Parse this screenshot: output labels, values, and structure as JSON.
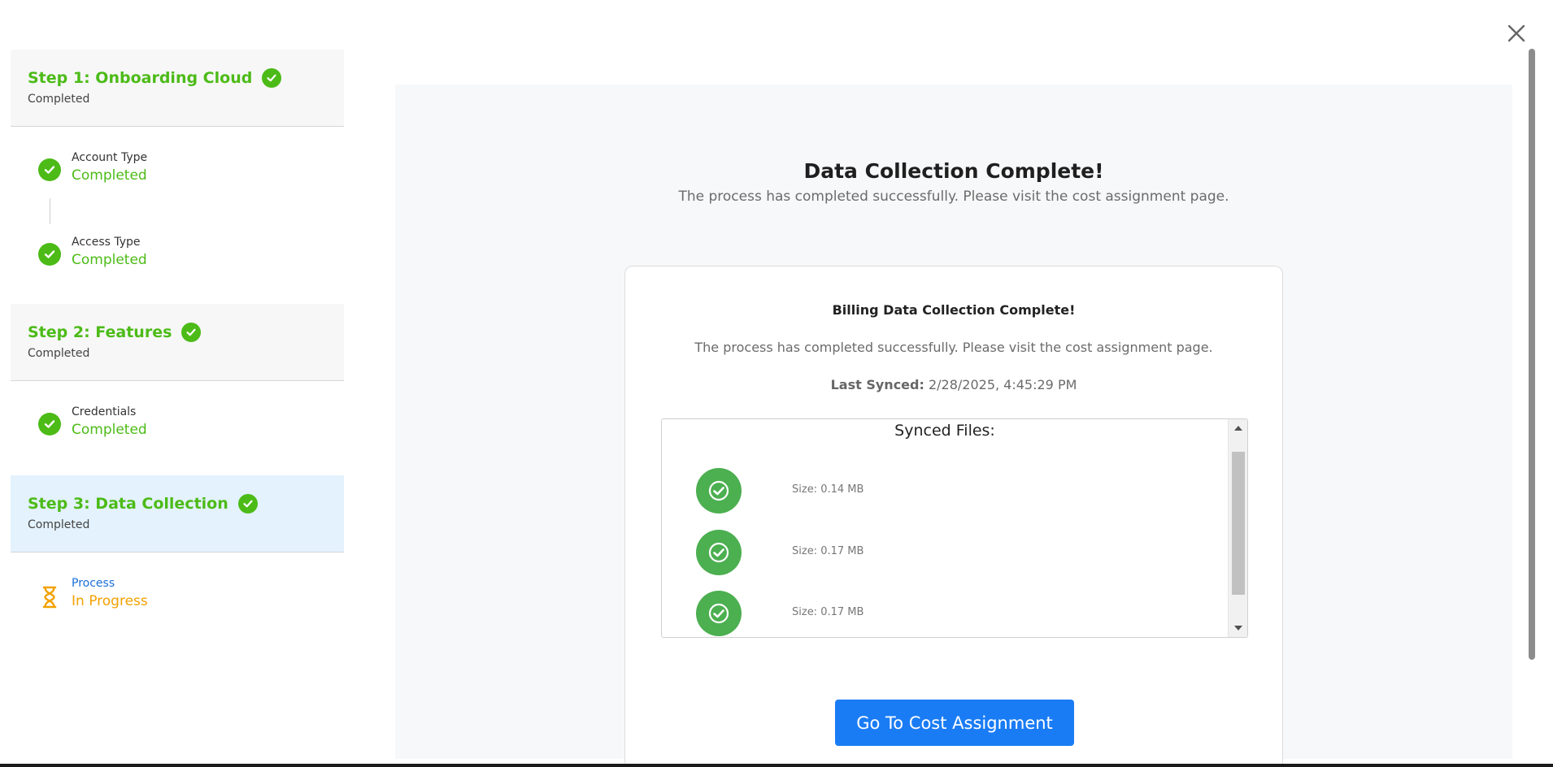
{
  "sidebar": {
    "steps": [
      {
        "title": "Step 1: Onboarding Cloud",
        "status": "Completed",
        "substeps": [
          {
            "label": "Account Type",
            "status": "Completed"
          },
          {
            "label": "Access Type",
            "status": "Completed"
          }
        ]
      },
      {
        "title": "Step 2: Features",
        "status": "Completed",
        "substeps": [
          {
            "label": "Credentials",
            "status": "Completed"
          }
        ]
      },
      {
        "title": "Step 3: Data Collection",
        "status": "Completed",
        "substeps": [
          {
            "label": "Process",
            "status": "In Progress",
            "icon": "hourglass-icon"
          }
        ]
      }
    ]
  },
  "main": {
    "title": "Data Collection Complete!",
    "subtitle": "The process has completed successfully. Please visit the cost assignment page.",
    "card": {
      "title": "Billing Data Collection Complete!",
      "subtitle": "The process has completed successfully. Please visit the cost assignment page.",
      "last_synced_label": "Last Synced:",
      "last_synced_value": " 2/28/2025, 4:45:29 PM",
      "files_title": "Synced Files:",
      "files": [
        {
          "size": "Size: 0.14 MB"
        },
        {
          "size": "Size: 0.17 MB"
        },
        {
          "size": "Size: 0.17 MB"
        }
      ],
      "cta_label": "Go To Cost Assignment"
    }
  },
  "colors": {
    "success": "#4cbb17",
    "file_success": "#4caf50",
    "in_progress": "#f2a100",
    "link_blue": "#1a6fd8",
    "primary_button": "#1a7cf5",
    "active_step_bg": "#e3f2fd"
  }
}
